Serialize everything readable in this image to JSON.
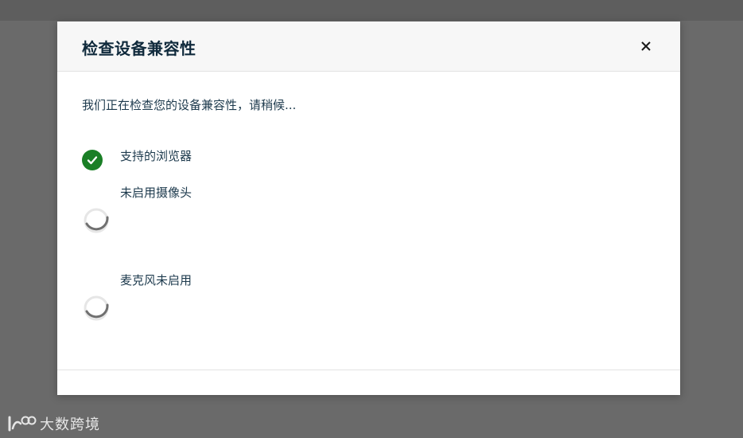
{
  "dialog": {
    "title": "检查设备兼容性",
    "close_label": "×",
    "intro": "我们正在检查您的设备兼容性，请稍候...",
    "checks": [
      {
        "label": "支持的浏览器",
        "status": "success",
        "icon": "check-circle-icon"
      },
      {
        "label": "未启用摄像头",
        "status": "loading",
        "icon": "spinner-icon"
      },
      {
        "label": "麦克风未启用",
        "status": "loading",
        "icon": "spinner-icon"
      }
    ]
  },
  "watermark": {
    "logo": "大数跨境-logo",
    "text": "大数跨境"
  },
  "colors": {
    "success": "#1a7f26",
    "title": "#102a3c",
    "overlay": "#6a6a6a",
    "spinner": "#6f6f6f"
  }
}
